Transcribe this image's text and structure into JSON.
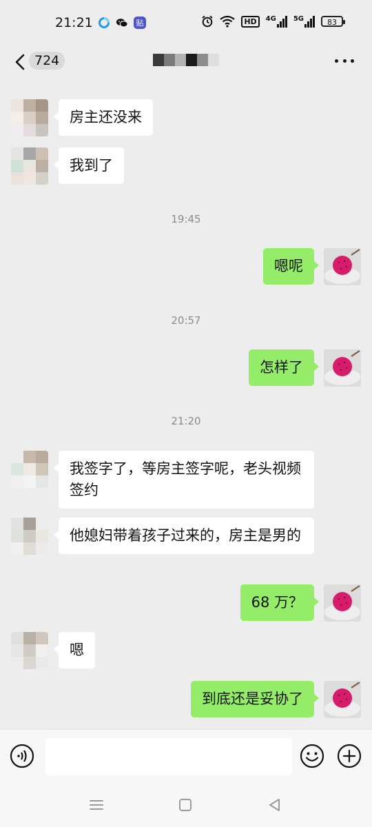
{
  "status_bar": {
    "time": "21:21",
    "app_icons": [
      "qq-browser-icon",
      "wechat-icon",
      "sticky-app-icon"
    ],
    "sticky_app_text": "贴",
    "network_hd": "HD",
    "network_4g": "4G",
    "network_5g": "5G",
    "battery": "83"
  },
  "header": {
    "unread_count": "724"
  },
  "messages": [
    {
      "side": "in",
      "text": "房主还没来"
    },
    {
      "side": "in",
      "text": "我到了"
    },
    {
      "side": "time",
      "text": "19:45"
    },
    {
      "side": "out",
      "text": "嗯呢"
    },
    {
      "side": "time",
      "text": "20:57"
    },
    {
      "side": "out",
      "text": "怎样了"
    },
    {
      "side": "time",
      "text": "21:20"
    },
    {
      "side": "in",
      "text": "我签字了，等房主签字呢，老头视频签约"
    },
    {
      "side": "in",
      "text": "他媳妇带着孩子过来的，房主是男的"
    },
    {
      "side": "out",
      "text": "68 万？"
    },
    {
      "side": "in",
      "text": "嗯"
    },
    {
      "side": "out",
      "text": "到底还是妥协了"
    }
  ],
  "colors": {
    "background": "#ededed",
    "outgoing_bubble": "#95ec69",
    "incoming_bubble": "#ffffff",
    "fruit": "#d81b6b"
  }
}
